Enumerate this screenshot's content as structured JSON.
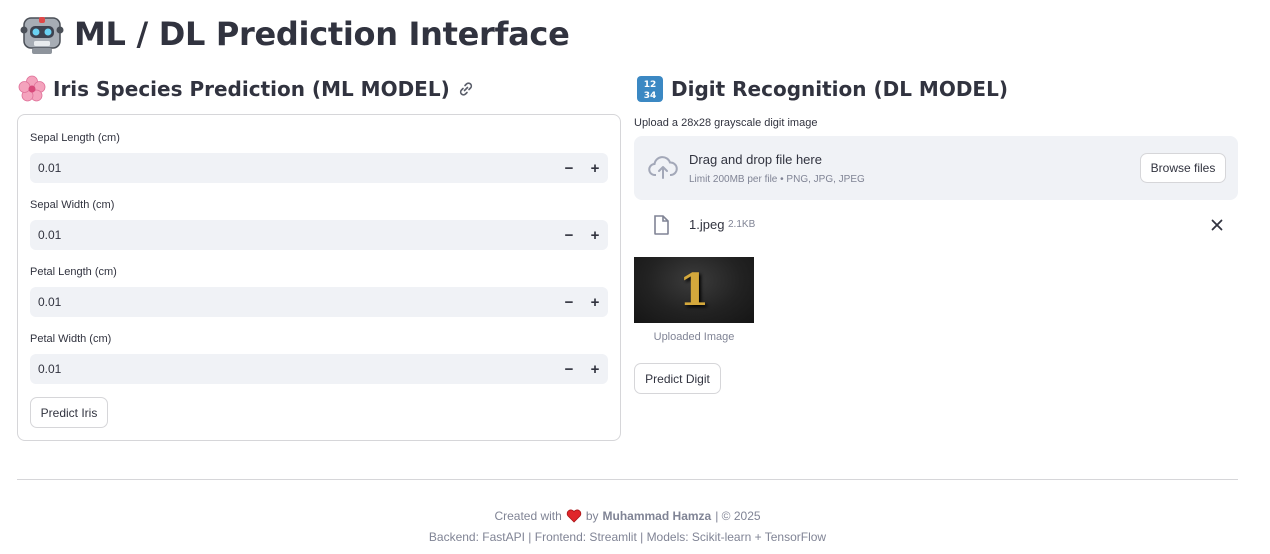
{
  "header": {
    "title": "ML / DL Prediction Interface",
    "icon": "robot-icon"
  },
  "iris": {
    "title": "Iris Species Prediction (ML MODEL)",
    "icon": "cherry-blossom-icon",
    "fields": [
      {
        "label": "Sepal Length (cm)",
        "value": "0.01",
        "minus": "−",
        "plus": "+"
      },
      {
        "label": "Sepal Width (cm)",
        "value": "0.01",
        "minus": "−",
        "plus": "+"
      },
      {
        "label": "Petal Length (cm)",
        "value": "0.01",
        "minus": "−",
        "plus": "+"
      },
      {
        "label": "Petal Width (cm)",
        "value": "0.01",
        "minus": "−",
        "plus": "+"
      }
    ],
    "predict_label": "Predict Iris"
  },
  "digit": {
    "title": "Digit Recognition (DL MODEL)",
    "icon": "numbers-icon",
    "upload_label": "Upload a 28x28 grayscale digit image",
    "drop_main": "Drag and drop file here",
    "drop_sub": "Limit 200MB per file • PNG, JPG, JPEG",
    "browse_label": "Browse files",
    "file_name": "1.jpeg",
    "file_size": "2.1KB",
    "image_digit": "1",
    "image_caption": "Uploaded Image",
    "predict_label": "Predict Digit"
  },
  "footer": {
    "created_prefix": "Created with",
    "by_text": "by",
    "author": "Muhammad Hamza",
    "year_text": "| © 2025",
    "stack_text": "Backend: FastAPI | Frontend: Streamlit | Models: Scikit-learn + TensorFlow"
  },
  "colors": {
    "text": "#31333f",
    "muted": "#808495",
    "input_bg": "#f0f2f6",
    "border": "#d6d6d9",
    "heart": "#e0262a"
  }
}
